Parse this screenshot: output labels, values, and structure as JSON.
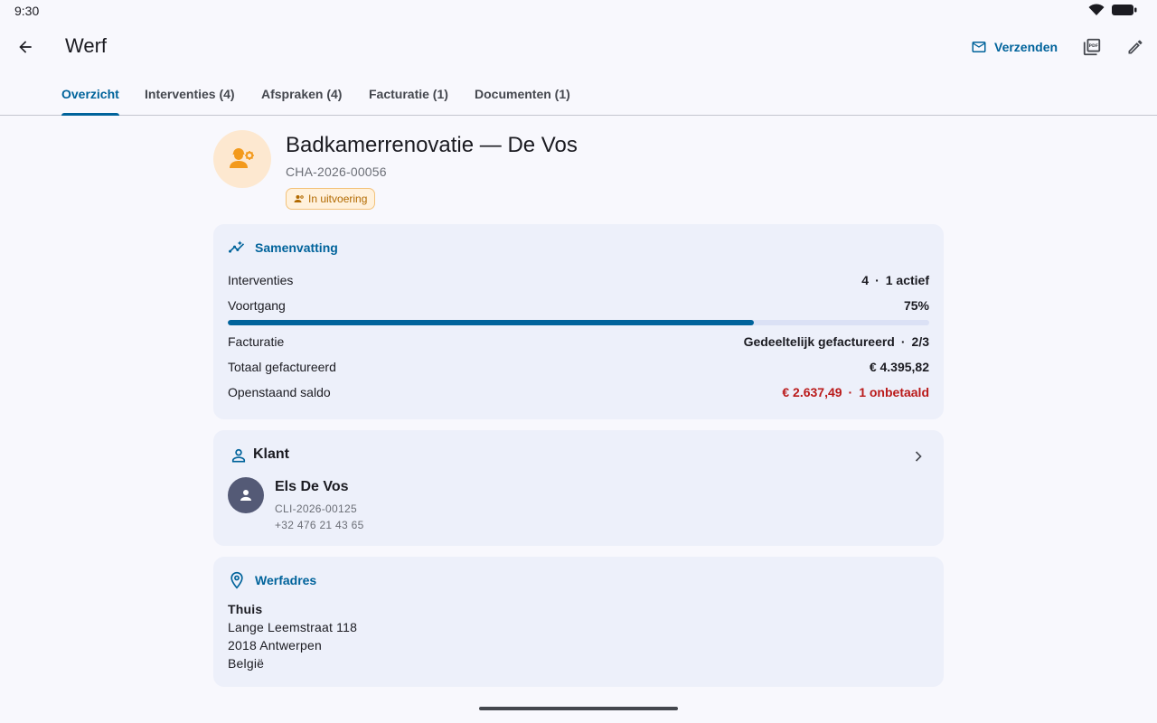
{
  "status_bar": {
    "time": "9:30"
  },
  "app_bar": {
    "title": "Werf",
    "send_label": "Verzenden"
  },
  "tabs": [
    {
      "label": "Overzicht",
      "active": true
    },
    {
      "label": "Interventies (4)",
      "active": false
    },
    {
      "label": "Afspraken (4)",
      "active": false
    },
    {
      "label": "Facturatie (1)",
      "active": false
    },
    {
      "label": "Documenten (1)",
      "active": false
    }
  ],
  "project": {
    "title": "Badkamerrenovatie — De Vos",
    "reference": "CHA-2026-00056",
    "status": "In uitvoering"
  },
  "summary": {
    "heading": "Samenvatting",
    "interventions": {
      "label": "Interventies",
      "count": "4",
      "active": "1 actief"
    },
    "progress": {
      "label": "Voortgang",
      "value": "75%",
      "fraction": 0.75
    },
    "billing": {
      "label": "Facturatie",
      "status": "Gedeeltelijk gefactureerd",
      "ratio": "2/3"
    },
    "total_invoiced": {
      "label": "Totaal gefactureerd",
      "value": "€ 4.395,82"
    },
    "outstanding": {
      "label": "Openstaand saldo",
      "value": "€ 2.637,49",
      "unpaid": "1 onbetaald"
    }
  },
  "client": {
    "heading": "Klant",
    "name": "Els De Vos",
    "reference": "CLI-2026-00125",
    "phone": "+32 476 21 43 65"
  },
  "address": {
    "heading": "Werfadres",
    "name": "Thuis",
    "street": "Lange Leemstraat 118",
    "city": "2018 Antwerpen",
    "country": "België"
  },
  "colors": {
    "accent": "#00639b",
    "error": "#ba1a1a",
    "status_bg": "#fff1dc",
    "status_fg": "#b26a00",
    "card_bg": "#edf0fa"
  },
  "icons": {
    "back": "arrow-left-icon",
    "send": "mail-icon",
    "pdf": "pdf-icon",
    "edit": "pencil-icon",
    "project": "engineer-icon",
    "summary": "insights-icon",
    "client": "person-icon",
    "address": "location-pin-icon"
  }
}
